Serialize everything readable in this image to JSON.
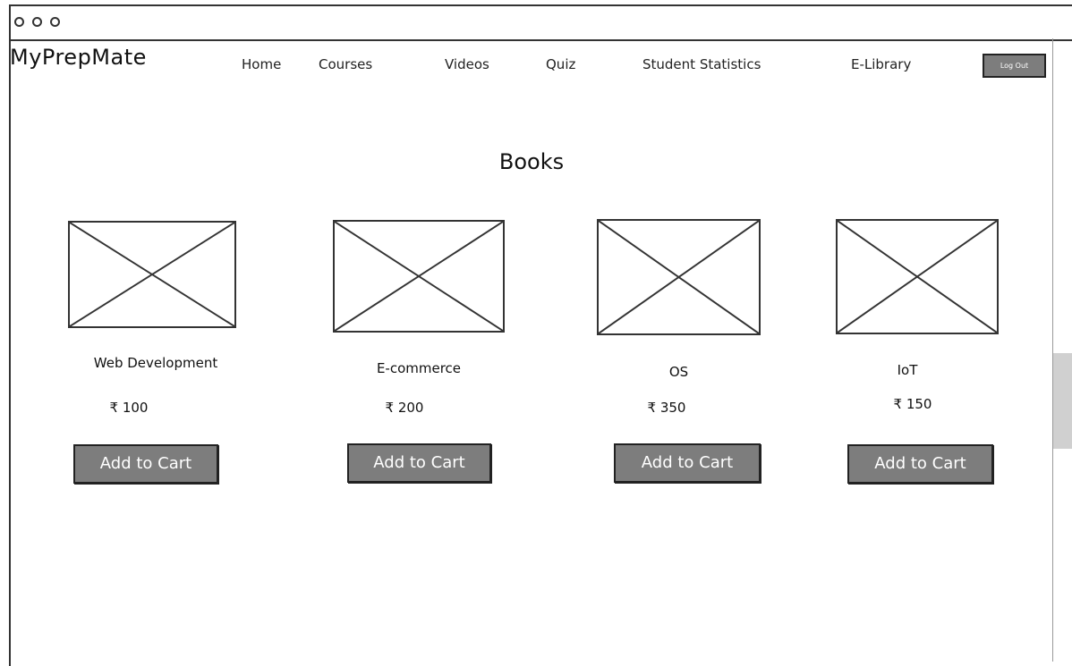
{
  "app": {
    "brand": "MyPrepMate"
  },
  "nav": {
    "items": [
      "Home",
      "Courses",
      "Videos",
      "Quiz",
      "Student Statistics",
      "E-Library"
    ],
    "logout_label": "Log Out"
  },
  "page": {
    "title": "Books"
  },
  "books": [
    {
      "title": "Web Development",
      "price": "₹ 100",
      "button": "Add to Cart"
    },
    {
      "title": "E-commerce",
      "price": "₹ 200",
      "button": "Add to Cart"
    },
    {
      "title": "OS",
      "price": "₹ 350",
      "button": "Add to Cart"
    },
    {
      "title": "IoT",
      "price": "₹ 150",
      "button": "Add to Cart"
    }
  ],
  "colors": {
    "button": "#7d7d7d",
    "outline": "#333333"
  },
  "icons": {
    "window_controls": "circle-dot-icon",
    "thumbnail": "image-placeholder-icon"
  }
}
